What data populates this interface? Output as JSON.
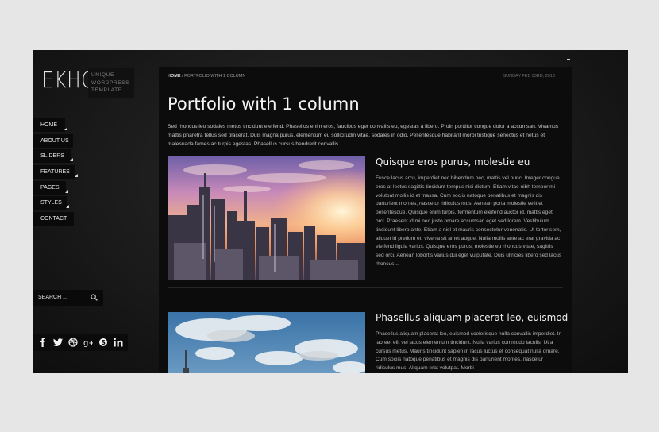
{
  "logo": {
    "name": "EKHO",
    "tagline": [
      "UNIQUE",
      "WORDPRESS",
      "TEMPLATE"
    ]
  },
  "nav": {
    "items": [
      "HOME",
      "ABOUT US",
      "SLIDERS",
      "FEATURES",
      "PAGES",
      "STYLES",
      "CONTACT"
    ]
  },
  "search": {
    "placeholder": "SEARCH ..."
  },
  "social": {
    "icons": [
      "facebook-icon",
      "twitter-icon",
      "dribbble-icon",
      "google-plus-icon",
      "skype-icon",
      "linkedin-icon"
    ]
  },
  "breadcrumb": {
    "home": "HOME",
    "separator": " / ",
    "current": "PORTFOLIO WITH 1 COLUMN"
  },
  "date": "SUNDAY FEB 03RD, 2013",
  "page": {
    "title": "Portfolio with 1 column",
    "intro": "Sed rhoncus leo sodales metus tincidunt eleifend. Phasellus enim eros, faucibus eget convallis eu, egestas a libero. Proin porttitor congue dolor a accumsan. Vivamus mattis pharetra tellus sed placerat. Duis magna purus, elementum eu sollicitudin vitae, sodales in odio. Pellentesque habitant morbi tristique senectus et netus et malesuada fames ac turpis egestas. Phasellus cursus hendrerit convallis."
  },
  "portfolio": [
    {
      "title": "Quisque eros purus, molestie eu",
      "text": "Fusce lacus arcu, imperdiet nec bibendum nec, mattis vel nunc. Integer congue eros at lectus sagittis tincidunt tempus nisi dictum. Etiam vitae nibh tempor mi volutpat mollis id et massa. Cum sociis natoque penatibus et magnis dis parturient montes, nascetur ridiculus mus. Aenean porta molestie velit et pellentesque. Quisque enim turpis, fermentum eleifend auctor id, mattis eget orci. Praesent id mi nec justo ornare accumsan eget sed lorem. Vestibulum tincidunt libero ante. Etiam a nisl et mauris consectetur venenatis. Ut tortor sem, aliquet id pretium et, viverra sit amet augue. Nulla mollis ante ac erat gravida ac eleifend ligula varius. Quisque eros purus, molestie eu rhoncus vitae, sagittis sed orci. Aenean lobortis varius dui eget vulputate. Duis ultricies libero sed lacus rhoncus..."
    },
    {
      "title": "Phasellus aliquam placerat leo, euismod",
      "text": "Phasellus aliquam placerat leo, euismod scelerisque nulla convallis imperdiet. In laoreet elit vel lacus elementum tincidunt. Nulla varius commodo iaculis. Ut a cursus metus. Mauris tincidunt sapien in lacus luctus et consequat nulla ornare. Cum sociis natoque penatibus et magnis dis parturient montes, nascetur ridiculus mus. Aliquam erat volutpat. Morbi"
    }
  ]
}
